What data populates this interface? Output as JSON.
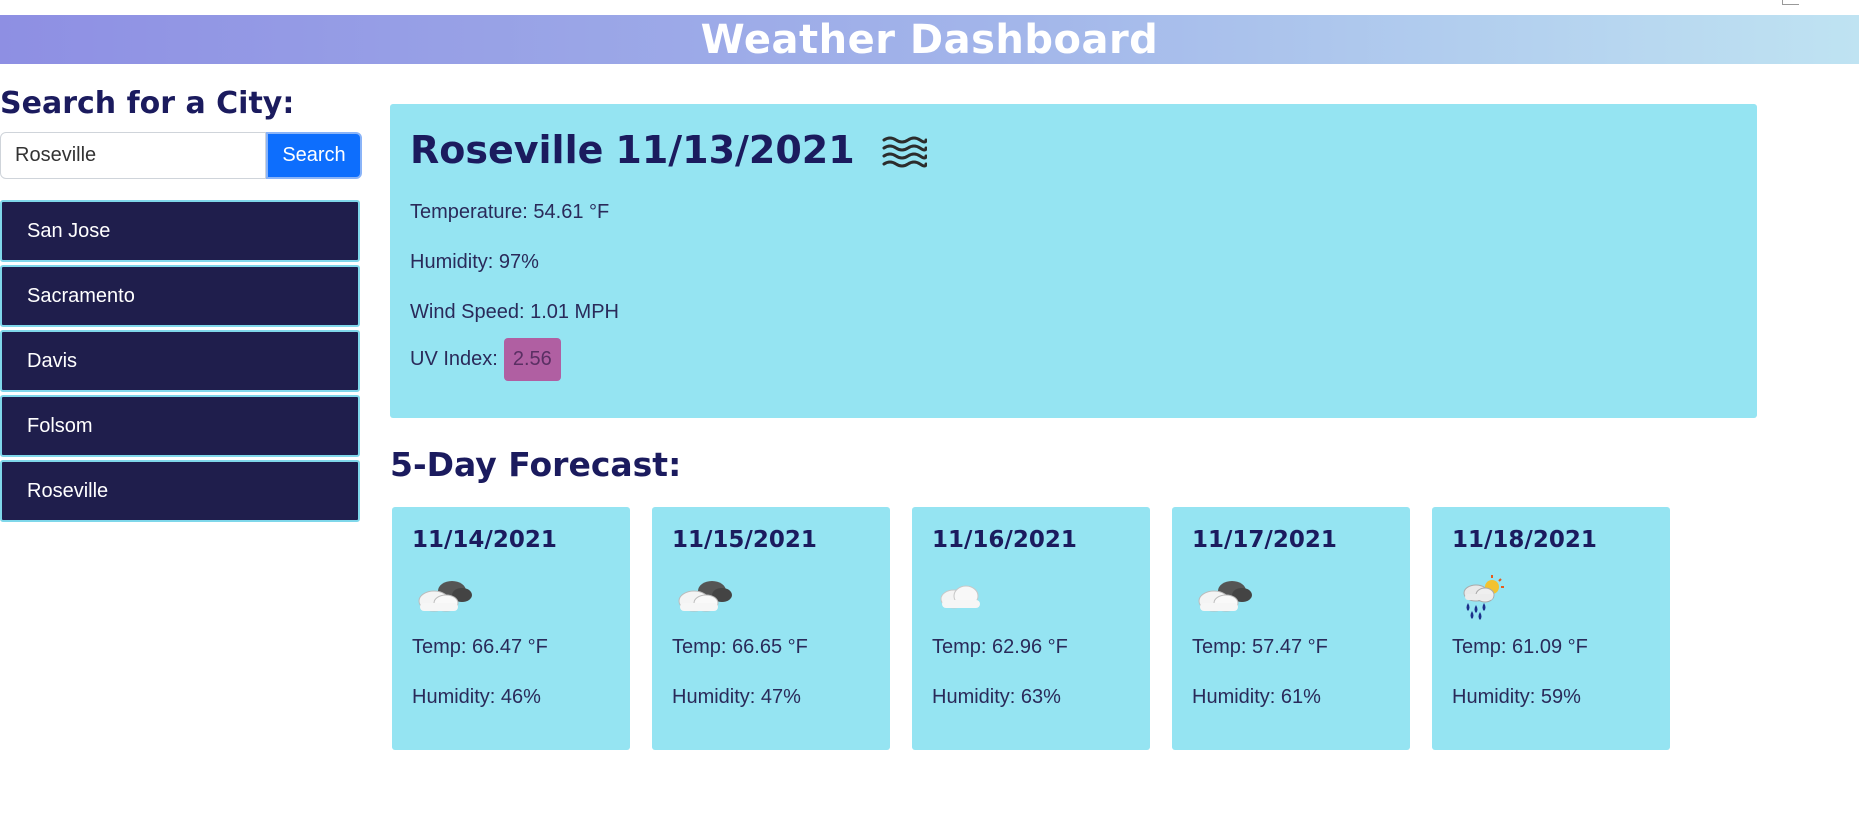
{
  "header": {
    "title": "Weather Dashboard"
  },
  "search": {
    "title": "Search for a City:",
    "value": "Roseville",
    "button_label": "Search"
  },
  "history": [
    "San Jose",
    "Sacramento",
    "Davis",
    "Folsom",
    "Roseville"
  ],
  "current": {
    "city": "Roseville",
    "date": "11/13/2021",
    "icon": "mist-icon",
    "temperature": "Temperature: 54.61 °F",
    "humidity": "Humidity: 97%",
    "wind": "Wind Speed: 1.01 MPH",
    "uv_label": "UV Index:",
    "uv_value": "2.56",
    "uv_color": "#b05fa2"
  },
  "forecast": {
    "title": "5-Day Forecast:",
    "days": [
      {
        "date": "11/14/2021",
        "icon": "broken-clouds-icon",
        "temp": "Temp: 66.47 °F",
        "humidity": "Humidity: 46%"
      },
      {
        "date": "11/15/2021",
        "icon": "broken-clouds-icon",
        "temp": "Temp: 66.65 °F",
        "humidity": "Humidity: 47%"
      },
      {
        "date": "11/16/2021",
        "icon": "cloud-icon",
        "temp": "Temp: 62.96 °F",
        "humidity": "Humidity: 63%"
      },
      {
        "date": "11/17/2021",
        "icon": "broken-clouds-icon",
        "temp": "Temp: 57.47 °F",
        "humidity": "Humidity: 61%"
      },
      {
        "date": "11/18/2021",
        "icon": "rain-sun-icon",
        "temp": "Temp: 61.09 °F",
        "humidity": "Humidity: 59%"
      }
    ]
  },
  "colors": {
    "header_gradient_start": "#8e8fe3",
    "header_gradient_end": "#bfe3f2",
    "card_background": "#95e4f2",
    "history_background": "#1f1e4c",
    "search_button": "#0d6efd",
    "heading_text": "#1b1b5e"
  }
}
